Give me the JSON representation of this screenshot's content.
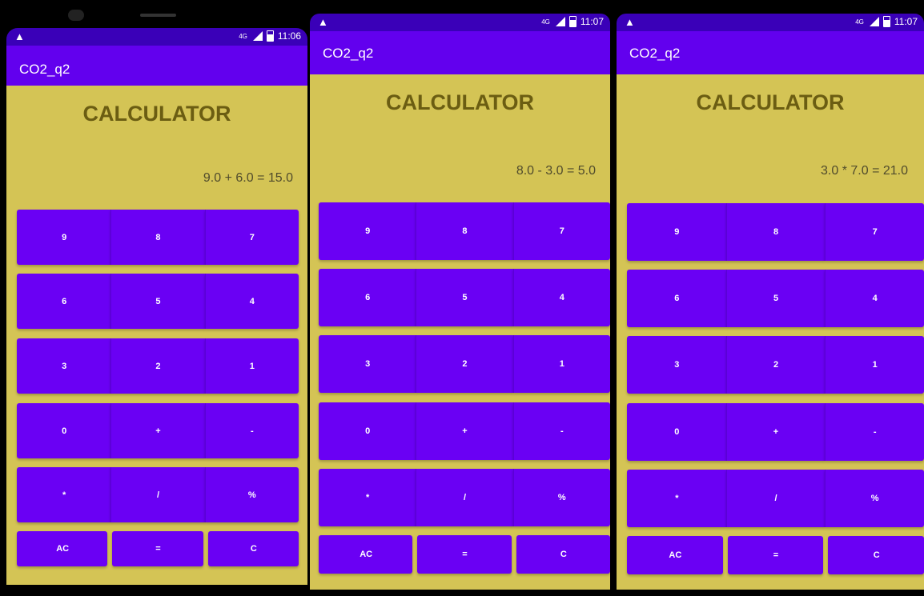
{
  "panels": [
    {
      "status": {
        "warning_icon": "warning-icon",
        "time": "11:06"
      },
      "app_title": "CO2_q2",
      "heading": "CALCULATOR",
      "result": "9.0 + 6.0 = 15.0",
      "rows": [
        [
          "9",
          "8",
          "7"
        ],
        [
          "6",
          "5",
          "4"
        ],
        [
          "3",
          "2",
          "1"
        ],
        [
          "0",
          "+",
          "-"
        ],
        [
          "*",
          "/",
          "%"
        ]
      ],
      "bottom": [
        "AC",
        "=",
        "C"
      ]
    },
    {
      "status": {
        "warning_icon": "warning-icon",
        "time": "11:07"
      },
      "app_title": "CO2_q2",
      "heading": "CALCULATOR",
      "result": "8.0 - 3.0 = 5.0",
      "rows": [
        [
          "9",
          "8",
          "7"
        ],
        [
          "6",
          "5",
          "4"
        ],
        [
          "3",
          "2",
          "1"
        ],
        [
          "0",
          "+",
          "-"
        ],
        [
          "*",
          "/",
          "%"
        ]
      ],
      "bottom": [
        "AC",
        "=",
        "C"
      ]
    },
    {
      "status": {
        "warning_icon": "warning-icon",
        "time": "11:07"
      },
      "app_title": "CO2_q2",
      "heading": "CALCULATOR",
      "result": "3.0 * 7.0 = 21.0",
      "rows": [
        [
          "9",
          "8",
          "7"
        ],
        [
          "6",
          "5",
          "4"
        ],
        [
          "3",
          "2",
          "1"
        ],
        [
          "0",
          "+",
          "-"
        ],
        [
          "*",
          "/",
          "%"
        ]
      ],
      "bottom": [
        "AC",
        "=",
        "C"
      ]
    }
  ],
  "colors": {
    "status_bar": "#3a00b8",
    "app_bar": "#6200ee",
    "background": "#d4c455",
    "button": "#6a00f4",
    "heading": "#6b5d12"
  }
}
